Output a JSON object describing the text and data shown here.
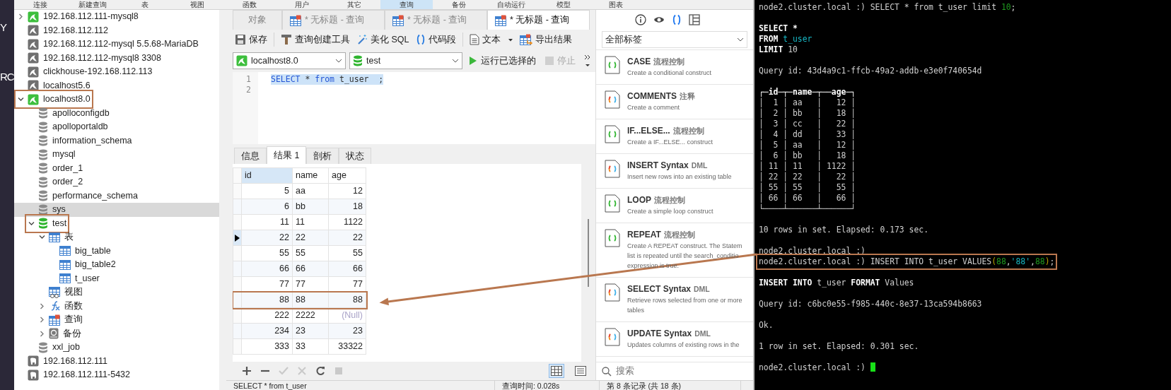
{
  "side_strip": [
    "Y",
    "RC"
  ],
  "menu": [
    {
      "label": "连接",
      "selected": false
    },
    {
      "label": "新建查询",
      "selected": false
    },
    {
      "label": "表",
      "selected": false
    },
    {
      "label": "视图",
      "selected": false
    },
    {
      "label": "函数",
      "selected": false
    },
    {
      "label": "用户",
      "selected": false
    },
    {
      "label": "其它",
      "selected": false
    },
    {
      "label": "查询",
      "selected": true
    },
    {
      "label": "备份",
      "selected": false
    },
    {
      "label": "自动运行",
      "selected": false
    },
    {
      "label": "模型",
      "selected": false
    },
    {
      "label": "图表",
      "selected": false
    }
  ],
  "tree": [
    {
      "label": "192.168.112.111-mysql8",
      "kind": "mysql",
      "open": true,
      "expanded": false,
      "selected": false
    },
    {
      "label": "192.168.112.112",
      "kind": "mysql",
      "open": false,
      "selected": false
    },
    {
      "label": "192.168.112.112-mysql 5.5.68-MariaDB",
      "kind": "mysql",
      "open": false,
      "selected": false
    },
    {
      "label": "192.168.112.112-mysql8 3308",
      "kind": "mysql",
      "open": false,
      "selected": false
    },
    {
      "label": "clickhouse-192.168.112.113",
      "kind": "mysql",
      "open": false,
      "selected": false
    },
    {
      "label": "localhost5.6",
      "kind": "mysql",
      "open": false,
      "selected": false
    },
    {
      "label": "localhost8.0",
      "kind": "mysql",
      "open": true,
      "expanded": true,
      "selected": false,
      "highlighted": true,
      "children": [
        {
          "label": "apolloconfigdb",
          "kind": "database",
          "open": false,
          "selected": false
        },
        {
          "label": "apolloportaldb",
          "kind": "database",
          "open": false,
          "selected": false
        },
        {
          "label": "information_schema",
          "kind": "database",
          "open": false,
          "selected": false
        },
        {
          "label": "mysql",
          "kind": "database",
          "open": false,
          "selected": false
        },
        {
          "label": "order_1",
          "kind": "database",
          "open": false,
          "selected": false
        },
        {
          "label": "order_2",
          "kind": "database",
          "open": false,
          "selected": false
        },
        {
          "label": "performance_schema",
          "kind": "database",
          "open": false,
          "selected": false
        },
        {
          "label": "sys",
          "kind": "database",
          "open": false,
          "selected": true
        },
        {
          "label": "test",
          "kind": "database",
          "open": true,
          "expanded": true,
          "selected": false,
          "highlighted": true,
          "children": [
            {
              "label": "表",
              "kind": "tables",
              "expanded": true,
              "selected": false,
              "children": [
                {
                  "label": "big_table",
                  "kind": "table",
                  "selected": false
                },
                {
                  "label": "big_table2",
                  "kind": "table",
                  "selected": false
                },
                {
                  "label": "t_user",
                  "kind": "table",
                  "selected": false
                }
              ]
            },
            {
              "label": "视图",
              "kind": "views",
              "selected": false
            },
            {
              "label": "函数",
              "kind": "functions",
              "expanded": false,
              "selected": false
            },
            {
              "label": "查询",
              "kind": "queries",
              "expanded": false,
              "selected": false
            },
            {
              "label": "备份",
              "kind": "backups",
              "expanded": false,
              "selected": false
            }
          ]
        },
        {
          "label": "xxl_job",
          "kind": "database",
          "open": false,
          "selected": false
        }
      ]
    },
    {
      "label": "192.168.112.111",
      "kind": "postgres",
      "open": false,
      "selected": false
    },
    {
      "label": "192.168.112.111-5432",
      "kind": "postgres",
      "open": false,
      "selected": false
    }
  ],
  "editor_tabs": [
    {
      "label": "对象",
      "kind": "object",
      "selected": false
    },
    {
      "label": "* 无标题 - 查询",
      "kind": "query",
      "selected": false
    },
    {
      "label": "* 无标题 - 查询",
      "kind": "query",
      "selected": false
    },
    {
      "label": "* 无标题 - 查询",
      "kind": "query",
      "selected": true
    }
  ],
  "toolbar": [
    {
      "label": "保存",
      "kind": "save"
    },
    {
      "label": "查询创建工具",
      "kind": "builder",
      "separated": true
    },
    {
      "label": "美化 SQL",
      "kind": "beautify"
    },
    {
      "label": "代码段",
      "kind": "snippet"
    },
    {
      "label": "文本",
      "kind": "text",
      "separated": true,
      "dropdown": true
    },
    {
      "label": "导出结果",
      "kind": "export"
    }
  ],
  "connection_select": {
    "value": "localhost8.0"
  },
  "database_select": {
    "value": "test"
  },
  "run_button": {
    "label": "运行已选择的"
  },
  "stop_button": {
    "label": "停止",
    "disabled": true
  },
  "editor": {
    "lines": [
      {
        "number": "1",
        "selected": true,
        "tokens": [
          {
            "text": "SELECT",
            "kind": "keyword"
          },
          {
            "text": " * ",
            "kind": "plain"
          },
          {
            "text": "from",
            "kind": "keyword"
          },
          {
            "text": " t_user  ;",
            "kind": "plain"
          }
        ]
      },
      {
        "number": "2",
        "selected": false
      }
    ]
  },
  "result_tabs": [
    {
      "label": "信息",
      "selected": false
    },
    {
      "label": "结果 1",
      "selected": true
    },
    {
      "label": "剖析",
      "selected": false
    },
    {
      "label": "状态",
      "selected": false
    }
  ],
  "grid": {
    "columns": [
      {
        "label": "id",
        "kind": "number",
        "selected": true
      },
      {
        "label": "name",
        "kind": "text",
        "selected": false
      },
      {
        "label": "age",
        "kind": "number",
        "selected": false
      }
    ],
    "rows": [
      {
        "cells": [
          "5",
          "aa",
          "12"
        ],
        "current": false
      },
      {
        "cells": [
          "6",
          "bb",
          "18"
        ],
        "current": false
      },
      {
        "cells": [
          "11",
          "11",
          "1122"
        ],
        "current": false
      },
      {
        "cells": [
          "22",
          "22",
          "22"
        ],
        "current": true
      },
      {
        "cells": [
          "55",
          "55",
          "55"
        ],
        "current": false
      },
      {
        "cells": [
          "66",
          "66",
          "66"
        ],
        "current": false
      },
      {
        "cells": [
          "77",
          "77",
          "77"
        ],
        "current": false
      },
      {
        "cells": [
          "88",
          "88",
          "88"
        ],
        "current": false,
        "highlighted": true
      },
      {
        "cells": [
          "222",
          "2222",
          "(Null)"
        ],
        "current": false,
        "nulls": [
          false,
          false,
          true
        ]
      },
      {
        "cells": [
          "234",
          "23",
          "23"
        ],
        "current": false
      },
      {
        "cells": [
          "333",
          "33",
          "33322"
        ],
        "current": false
      }
    ]
  },
  "grid_actions": [
    {
      "kind": "add",
      "disabled": false
    },
    {
      "kind": "remove",
      "disabled": false
    },
    {
      "kind": "apply",
      "disabled": true
    },
    {
      "kind": "discard",
      "disabled": true
    },
    {
      "kind": "refresh",
      "disabled": false
    },
    {
      "kind": "stop",
      "disabled": true
    }
  ],
  "view_toggles": [
    {
      "kind": "grid",
      "selected": true
    },
    {
      "kind": "form",
      "selected": false
    }
  ],
  "status_bar": [
    "SELECT * from t_user",
    "查询时间: 0.028s",
    "第 8 条记录 (共 18 条)"
  ],
  "snippet_panel": {
    "header_icons": [
      {
        "kind": "info",
        "selected": false
      },
      {
        "kind": "preview",
        "selected": false
      },
      {
        "kind": "snippets",
        "selected": true
      },
      {
        "kind": "layout",
        "selected": false
      }
    ],
    "filter": {
      "value": "全部标签"
    },
    "items": [
      {
        "title": "CASE",
        "tag": "流程控制",
        "kind": "plain",
        "description": [
          "Create a conditional construct"
        ]
      },
      {
        "title": "COMMENTS",
        "tag": "注释",
        "kind": "colorful",
        "description": [
          "Create a comment"
        ]
      },
      {
        "title": "IF...ELSE...",
        "tag": "流程控制",
        "kind": "plain",
        "description": [
          "Create a IF...ELSE... construct"
        ]
      },
      {
        "title": "INSERT Syntax",
        "tag": "DML",
        "kind": "colorful",
        "description": [
          "Insert new rows into an existing table"
        ]
      },
      {
        "title": "LOOP",
        "tag": "流程控制",
        "kind": "plain",
        "description": [
          "Create a simple loop construct"
        ]
      },
      {
        "title": "REPEAT",
        "tag": "流程控制",
        "kind": "plain",
        "description": [
          "Create A REPEAT construct. The Statem",
          "list is repeated until the search_conditio",
          "expression is true."
        ]
      },
      {
        "title": "SELECT Syntax",
        "tag": "DML",
        "kind": "colorful",
        "description": [
          "Retrieve rows selected from one or more",
          "tables"
        ]
      },
      {
        "title": "UPDATE Syntax",
        "tag": "DML",
        "kind": "colorful",
        "description": [
          "Updates columns of existing rows in the"
        ]
      }
    ],
    "search": {
      "placeholder": "搜索"
    }
  },
  "terminal": {
    "blocks": [
      {
        "lines": [
          {
            "segments": [
              {
                "text": "node2.cluster.local :) SELECT * from t_user limit ",
                "kind": "plain"
              },
              {
                "text": "10",
                "kind": "green"
              },
              {
                "text": ";",
                "kind": "plain"
              }
            ]
          }
        ]
      },
      {
        "lines": [
          {
            "segments": [
              {
                "text": "SELECT *",
                "kind": "bold"
              }
            ]
          },
          {
            "segments": [
              {
                "text": "FROM ",
                "kind": "bold"
              },
              {
                "text": "t_user",
                "kind": "cyan"
              }
            ]
          },
          {
            "segments": [
              {
                "text": "LIMIT",
                "kind": "bold"
              },
              {
                "text": " 10",
                "kind": "plain"
              }
            ]
          }
        ]
      },
      {
        "lines": [
          {
            "text": "Query id: 43d4a9c1-ffcb-49a2-addb-e3e0f740654d"
          }
        ]
      },
      {
        "lines": [
          {
            "segments": [
              {
                "text": "┌─id─┬─name─┬──age─┐",
                "kind": "bold"
              }
            ]
          },
          {
            "text": "│  1 │ aa   │   12 │"
          },
          {
            "text": "│  2 │ bb   │   18 │"
          },
          {
            "text": "│  3 │ cc   │   22 │"
          },
          {
            "text": "│  4 │ dd   │   33 │"
          },
          {
            "text": "│  5 │ aa   │   12 │"
          },
          {
            "text": "│  6 │ bb   │   18 │"
          },
          {
            "text": "│ 11 │ 11   │ 1122 │"
          },
          {
            "text": "│ 22 │ 22   │   22 │"
          },
          {
            "text": "│ 55 │ 55   │   55 │"
          },
          {
            "text": "│ 66 │ 66   │   66 │"
          },
          {
            "text": "└────┴──────┴──────┘"
          }
        ]
      },
      {
        "lines": [
          {
            "text": "10 rows in set. Elapsed: 0.173 sec."
          }
        ]
      },
      {
        "lines": [
          {
            "text": "node2.cluster.local :)"
          },
          {
            "segments": [
              {
                "text": "node2.cluster.local :) INSERT INTO t_user VALUES",
                "kind": "plain"
              },
              {
                "text": "(",
                "kind": "yellow"
              },
              {
                "text": "88",
                "kind": "green"
              },
              {
                "text": ",",
                "kind": "plain"
              },
              {
                "text": "'88'",
                "kind": "cyan"
              },
              {
                "text": ",",
                "kind": "plain"
              },
              {
                "text": "88",
                "kind": "green"
              },
              {
                "text": ")",
                "kind": "yellow"
              },
              {
                "text": ";",
                "kind": "plain"
              }
            ],
            "highlighted": true
          }
        ]
      },
      {
        "lines": [
          {
            "segments": [
              {
                "text": "INSERT INTO",
                "kind": "bold"
              },
              {
                "text": " t_user ",
                "kind": "plain"
              },
              {
                "text": "FORMAT",
                "kind": "bold"
              },
              {
                "text": " Values",
                "kind": "plain"
              }
            ]
          }
        ]
      },
      {
        "lines": [
          {
            "text": "Query id: c6bc0e55-f985-440c-8e37-13ca594b8663"
          }
        ]
      },
      {
        "lines": [
          {
            "text": "Ok."
          }
        ]
      },
      {
        "lines": [
          {
            "text": "1 row in set. Elapsed: 0.301 sec."
          }
        ]
      },
      {
        "lines": [
          {
            "text": "node2.cluster.local :)",
            "cursor": true
          }
        ]
      }
    ]
  },
  "annotations": {
    "arrow": true
  }
}
